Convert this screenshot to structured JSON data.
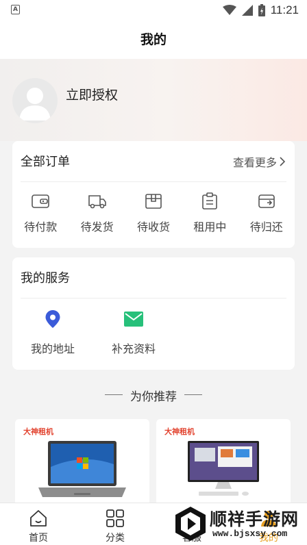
{
  "status_bar": {
    "time": "11:21",
    "left_badge": "A"
  },
  "header": {
    "title": "我的"
  },
  "profile": {
    "auth_label": "立即授权"
  },
  "orders": {
    "title": "全部订单",
    "more_label": "查看更多",
    "items": [
      {
        "label": "待付款",
        "icon": "wallet-icon"
      },
      {
        "label": "待发货",
        "icon": "truck-icon"
      },
      {
        "label": "待收货",
        "icon": "package-icon"
      },
      {
        "label": "租用中",
        "icon": "clipboard-icon"
      },
      {
        "label": "待归还",
        "icon": "return-box-icon"
      }
    ]
  },
  "services": {
    "title": "我的服务",
    "items": [
      {
        "label": "我的地址",
        "icon": "location-pin-icon",
        "color": "#3b5bd9"
      },
      {
        "label": "补充资料",
        "icon": "mail-icon",
        "color": "#27c07a"
      }
    ]
  },
  "recommend": {
    "title": "为你推荐",
    "products": [
      {
        "brand": "大神租机",
        "image": "laptop"
      },
      {
        "brand": "大神租机",
        "image": "all-in-one-desktop"
      }
    ]
  },
  "tabbar": {
    "active_color": "#e8a021",
    "items": [
      {
        "label": "首页",
        "icon": "home-icon"
      },
      {
        "label": "分类",
        "icon": "category-grid-icon"
      },
      {
        "label": "客服",
        "icon": "customer-service-icon"
      },
      {
        "label": "我的",
        "icon": "user-icon"
      }
    ]
  },
  "watermark": {
    "name": "顺祥手游网",
    "url": "www.bjsxsy.com"
  }
}
